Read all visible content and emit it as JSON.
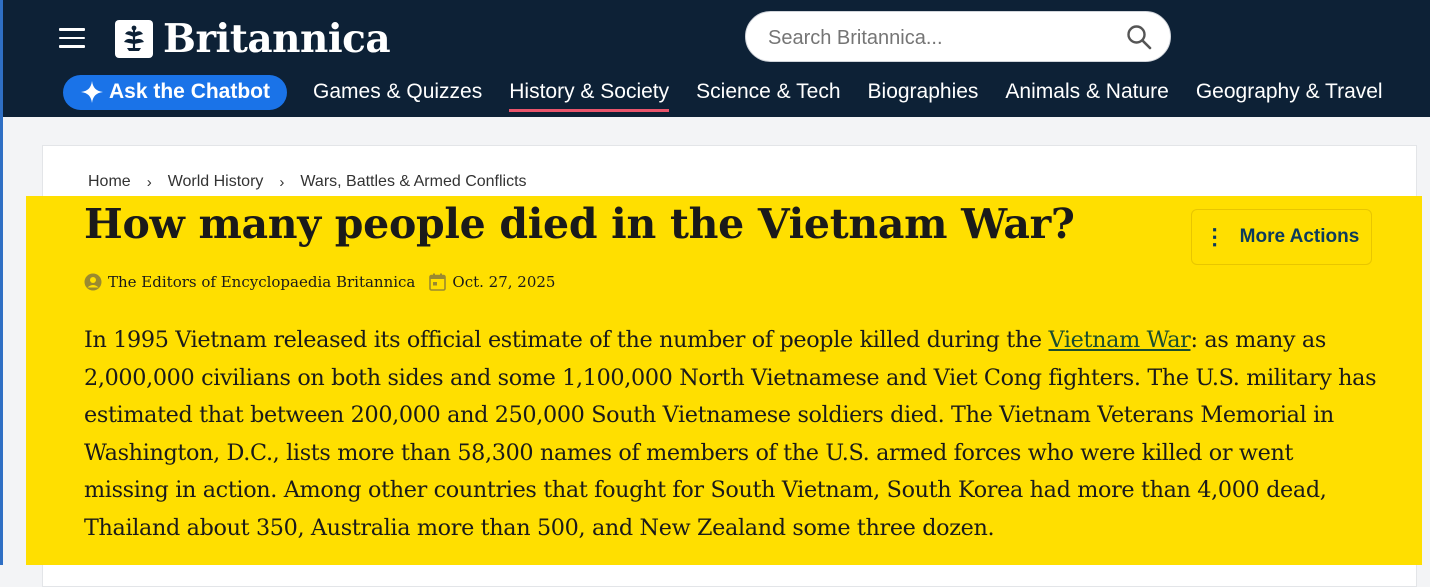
{
  "header": {
    "logo_text": "Britannica",
    "search_placeholder": "Search Britannica...",
    "chatbot_label": "Ask the Chatbot",
    "nav": [
      {
        "label": "Games & Quizzes"
      },
      {
        "label": "History & Society",
        "active": true
      },
      {
        "label": "Science & Tech"
      },
      {
        "label": "Biographies"
      },
      {
        "label": "Animals & Nature"
      },
      {
        "label": "Geography & Travel"
      }
    ]
  },
  "breadcrumb": [
    "Home",
    "World History",
    "Wars, Battles & Armed Conflicts"
  ],
  "article": {
    "title": "How many people died in the Vietnam War?",
    "more_actions_label": "More Actions",
    "author": "The Editors of Encyclopaedia Britannica",
    "date": "Oct. 27, 2025",
    "body_pre_link": "In 1995 Vietnam released its official estimate of the number of people killed during the ",
    "body_link": "Vietnam War",
    "body_post_link": ": as many as 2,000,000 civilians on both sides and some 1,100,000 North Vietnamese and Viet Cong fighters. The U.S. military has estimated that between 200,000 and 250,000 South Vietnamese soldiers died. The Vietnam Veterans Memorial in Washington, D.C., lists more than 58,300 names of members of the U.S. armed forces who were killed or went missing in action. Among other countries that fought for South Vietnam, South Korea had more than 4,000 dead, Thailand about 350, Australia more than 500, and New Zealand some three dozen."
  },
  "colors": {
    "header_bg": "#0d2136",
    "chatbot_bg": "#1a73e8",
    "active_underline": "#e9546b",
    "highlight": "#ffdf00"
  },
  "icons": [
    "hamburger-menu-icon",
    "britannica-thistle-icon",
    "search-icon",
    "sparkle-icon",
    "chevron-right-icon",
    "more-vertical-icon",
    "user-circle-icon",
    "calendar-icon"
  ]
}
